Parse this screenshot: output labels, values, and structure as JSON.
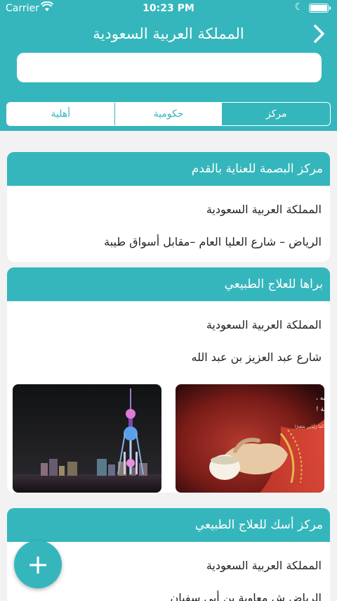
{
  "status": {
    "carrier": "Carrier",
    "time": "10:23 PM"
  },
  "nav": {
    "title": "المملكة العربية السعودية"
  },
  "search": {
    "value": "",
    "placeholder": ""
  },
  "tabs": [
    {
      "label": "مركز",
      "active": true
    },
    {
      "label": "حكومية",
      "active": false
    },
    {
      "label": "أهلية",
      "active": false
    }
  ],
  "cards": [
    {
      "name": "مركز البصمة للعناية بالقدم",
      "country": "المملكة العربية السعودية",
      "address": "الرياض – شارع العليا العام –مقابل أسواق طيبة"
    },
    {
      "name": "براها للعلاج الطبيعي",
      "country": "المملكة العربية السعودية",
      "address": "شارع عبد العزيز بن عبد الله",
      "photo_caption_lines": [
        "ومن كانت بين يديه فليحمد ربه ،",
        "فلا زال عنده باب من أبواب الجنة !"
      ],
      "photo_caption_small": "ربِّ ارْحَمْهُمَا كَمَا رَبَّيَانِي صَغِيرًا"
    },
    {
      "name": "مركز أسك للعلاج الطبيعي",
      "country": "المملكة العربية السعودية",
      "address": "الرياض ش معاوية بن أبي سفيان"
    }
  ],
  "fab": {
    "label": "+"
  },
  "colors": {
    "accent": "#35b6bc"
  }
}
